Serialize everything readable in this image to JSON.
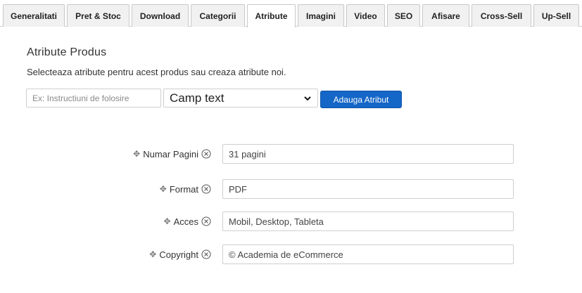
{
  "tabs": [
    {
      "label": "Generalitati",
      "active": false
    },
    {
      "label": "Pret & Stoc",
      "active": false
    },
    {
      "label": "Download",
      "active": false
    },
    {
      "label": "Categorii",
      "active": false
    },
    {
      "label": "Atribute",
      "active": true
    },
    {
      "label": "Imagini",
      "active": false
    },
    {
      "label": "Video",
      "active": false
    },
    {
      "label": "SEO",
      "active": false
    },
    {
      "label": "Afisare",
      "active": false
    },
    {
      "label": "Cross-Sell",
      "active": false
    },
    {
      "label": "Up-Sell",
      "active": false
    }
  ],
  "section": {
    "title": "Atribute Produs",
    "description": "Selecteaza atribute pentru acest produs sau creaza atribute noi."
  },
  "new_attribute": {
    "name_placeholder": "Ex: Instructiuni de folosire",
    "type_selected": "Camp text",
    "add_label": "Adauga Atribut"
  },
  "attributes": [
    {
      "label": "Numar Pagini",
      "value": "31 pagini"
    },
    {
      "label": "Format",
      "value": "PDF"
    },
    {
      "label": "Acces",
      "value": "Mobil, Desktop, Tableta"
    },
    {
      "label": "Copyright",
      "value": "© Academia de eCommerce"
    }
  ],
  "icons": {
    "drag": "move-handle-icon",
    "remove": "remove-circle-icon",
    "select_caret": "chevron-down-icon"
  },
  "colors": {
    "accent": "#1466c7",
    "tab_bg": "#f1f1f1",
    "border": "#cfcfcf"
  }
}
